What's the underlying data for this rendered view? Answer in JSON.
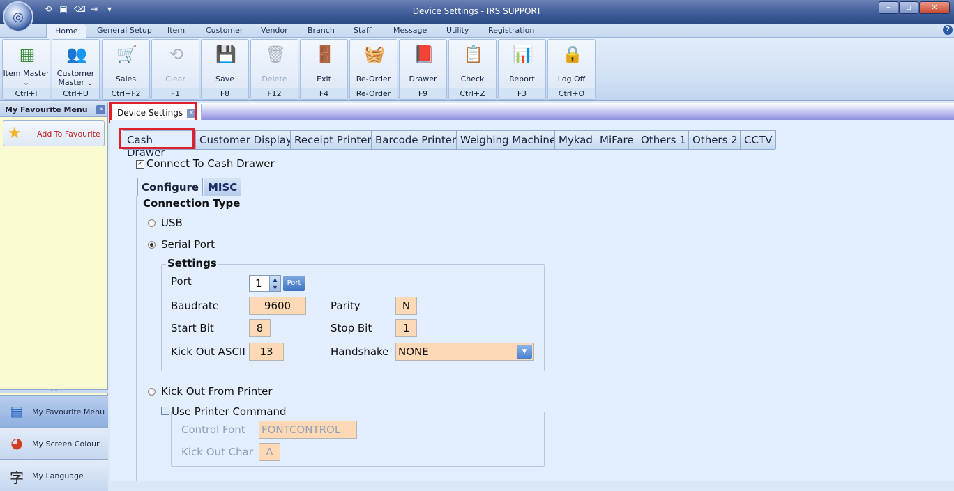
{
  "window": {
    "title": "Device Settings - IRS SUPPORT"
  },
  "menu": {
    "tabs": [
      "Home",
      "General Setup",
      "Item",
      "Customer",
      "Vendor",
      "Branch",
      "Staff",
      "Message",
      "Utility",
      "Registration"
    ],
    "help": "?"
  },
  "ribbon": {
    "buttons": [
      {
        "label": "Item Master ⌄",
        "shortcut": "Ctrl+I",
        "icon": "item-master-icon"
      },
      {
        "label": "Customer Master ⌄",
        "shortcut": "Ctrl+U",
        "icon": "customer-master-icon"
      },
      {
        "label": "Sales",
        "shortcut": "Ctrl+F2",
        "icon": "shopping-cart-icon"
      },
      {
        "label": "Clear",
        "shortcut": "F1",
        "icon": "clear-icon"
      },
      {
        "label": "Save",
        "shortcut": "F8",
        "icon": "floppy-disk-icon"
      },
      {
        "label": "Delete",
        "shortcut": "F12",
        "icon": "trash-icon"
      },
      {
        "label": "Exit",
        "shortcut": "F4",
        "icon": "exit-door-icon"
      },
      {
        "label": "Re-Order",
        "shortcut": "Re-Order",
        "icon": "basket-icon"
      },
      {
        "label": "Drawer",
        "shortcut": "F9",
        "icon": "drawer-icon"
      },
      {
        "label": "Check",
        "shortcut": "Ctrl+Z",
        "icon": "checklist-icon"
      },
      {
        "label": "Report",
        "shortcut": "F3",
        "icon": "bar-chart-icon"
      },
      {
        "label": "Log Off",
        "shortcut": "Ctrl+O",
        "icon": "lock-icon"
      }
    ]
  },
  "sidebar": {
    "title": "My Favourite Menu",
    "add_favourite": "Add To Favourite",
    "nav": [
      "My Favourite Menu",
      "My Screen Colour",
      "My Language"
    ]
  },
  "document_tab": {
    "label": "Device Settings"
  },
  "device_tabs": [
    "Cash Drawer",
    "Customer Display",
    "Receipt Printer",
    "Barcode Printer",
    "Weighing Machine",
    "Mykad",
    "MiFare",
    "Others 1",
    "Others 2",
    "CCTV"
  ],
  "cash_drawer": {
    "connect_label": "Connect To Cash Drawer",
    "connect_checked": true,
    "subtabs": [
      "Configure",
      "MISC"
    ],
    "connection_type_title": "Connection Type",
    "usb_label": "USB",
    "serial_label": "Serial Port",
    "selected_connection": "Serial Port",
    "settings": {
      "title": "Settings",
      "port_label": "Port",
      "port_value": "1",
      "port_button": "Port",
      "baudrate_label": "Baudrate",
      "baudrate_value": "9600",
      "parity_label": "Parity",
      "parity_value": "N",
      "startbit_label": "Start Bit",
      "startbit_value": "8",
      "stopbit_label": "Stop Bit",
      "stopbit_value": "1",
      "kickout_ascii_label": "Kick Out ASCII",
      "kickout_ascii_value": "13",
      "handshake_label": "Handshake",
      "handshake_value": "NONE"
    },
    "kickout_printer_label": "Kick Out From Printer",
    "use_printer_command_label": "Use Printer Command",
    "use_printer_command_checked": false,
    "control_font_label": "Control Font",
    "control_font_value": "FONTCONTROL",
    "kickout_char_label": "Kick Out Char",
    "kickout_char_value": "A"
  }
}
